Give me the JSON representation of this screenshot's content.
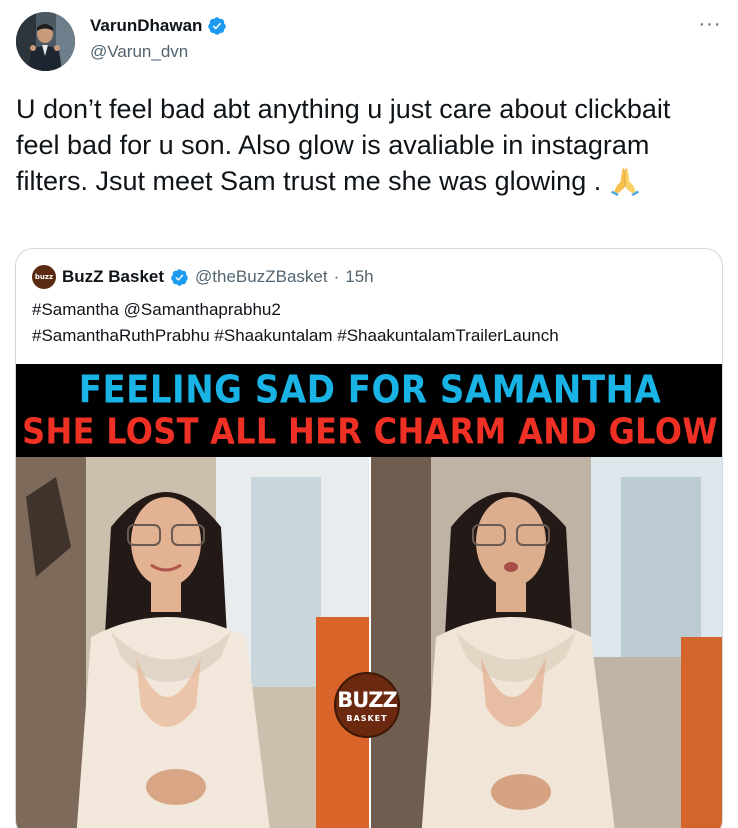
{
  "author": {
    "name": "VarunDhawan",
    "handle": "@Varun_dvn",
    "verified": true
  },
  "more_menu": "···",
  "tweet_text": "U don’t feel bad abt anything u just care about clickbait feel bad for u son. Also glow is avaliable in instagram filters. Jsut meet Sam trust me she was glowing . ",
  "tweet_emoji": "folded-hands-emoji",
  "quoted_tweet": {
    "avatar_label": "buzz",
    "name": "BuzZ Basket",
    "verified": true,
    "handle": "@theBuzZBasket",
    "separator": "·",
    "time": "15h",
    "text_line1": "#Samantha @Samanthaprabhu2",
    "text_line2": "#SamanthaRuthPrabhu #Shaakuntalam #ShaakuntalamTrailerLaunch",
    "media": {
      "headline1": "FEELING SAD FOR SAMANTHA",
      "headline2": "SHE LOST ALL HER CHARM AND GLOW",
      "logo_line1": "BUZZ",
      "logo_line2": "BASKET",
      "headline1_color": "#19b3e6",
      "headline2_color": "#ee3124"
    }
  },
  "colors": {
    "text": "#0f1419",
    "secondary": "#536471",
    "verified": "#1d9bf0",
    "border": "#cfd9de"
  }
}
